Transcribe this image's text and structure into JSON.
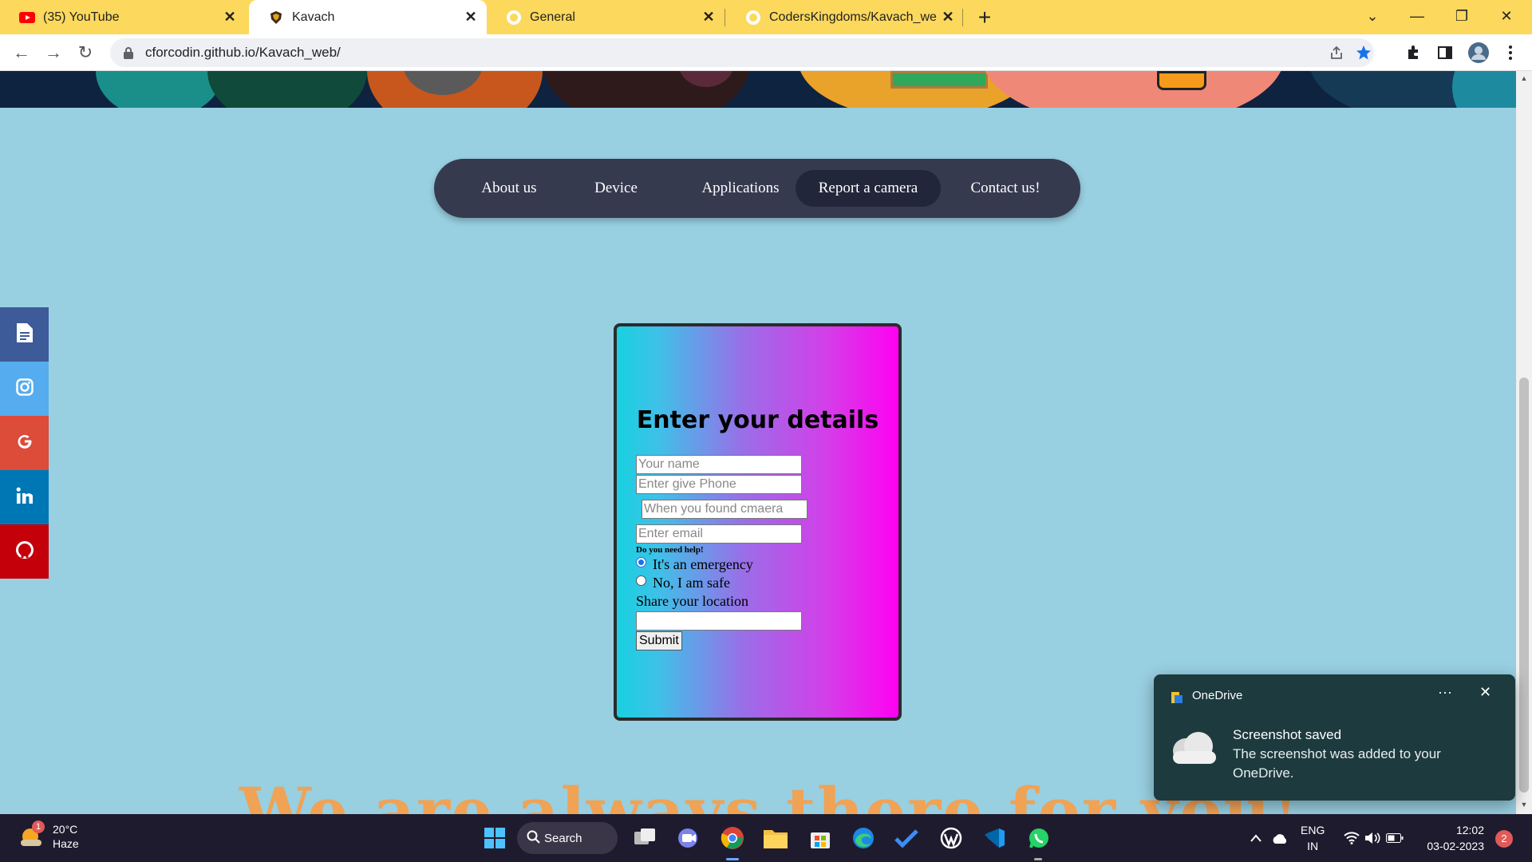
{
  "browser": {
    "tabs": [
      {
        "title": "(35) YouTube",
        "icon": "youtube-icon",
        "active": false
      },
      {
        "title": "Kavach",
        "icon": "kavach-favicon",
        "active": true
      },
      {
        "title": "General",
        "icon": "github-icon",
        "active": false
      },
      {
        "title": "CodersKingdoms/Kavach_web",
        "icon": "github-icon",
        "active": false
      }
    ],
    "url": "cforcodin.github.io/Kavach_web/"
  },
  "nav": {
    "items": [
      "About us",
      "Device",
      "Applications",
      "Report a camera",
      "Contact us!"
    ],
    "active": "Report a camera"
  },
  "social": [
    "document-icon",
    "instagram-icon",
    "google-icon",
    "linkedin-icon",
    "github-icon"
  ],
  "form": {
    "title": "Enter your details",
    "name_placeholder": "Your name",
    "phone_placeholder": "Enter give Phone",
    "date_placeholder": "When you found cmaera",
    "email_placeholder": "Enter email",
    "help_label": "Do you need help!",
    "option_emergency": "It's an emergency",
    "option_safe": "No, I am safe",
    "location_label": "Share your location",
    "submit_label": "Submit"
  },
  "hero_heading": "We are always there for you!",
  "toast": {
    "app": "OneDrive",
    "title": "Screenshot saved",
    "body": "The screenshot was added to your OneDrive."
  },
  "taskbar": {
    "weather_temp": "20°C",
    "weather_desc": "Haze",
    "weather_badge": "1",
    "search_label": "Search",
    "lang_top": "ENG",
    "lang_bottom": "IN",
    "time": "12:02",
    "date": "03-02-2023",
    "notifications": "2"
  }
}
